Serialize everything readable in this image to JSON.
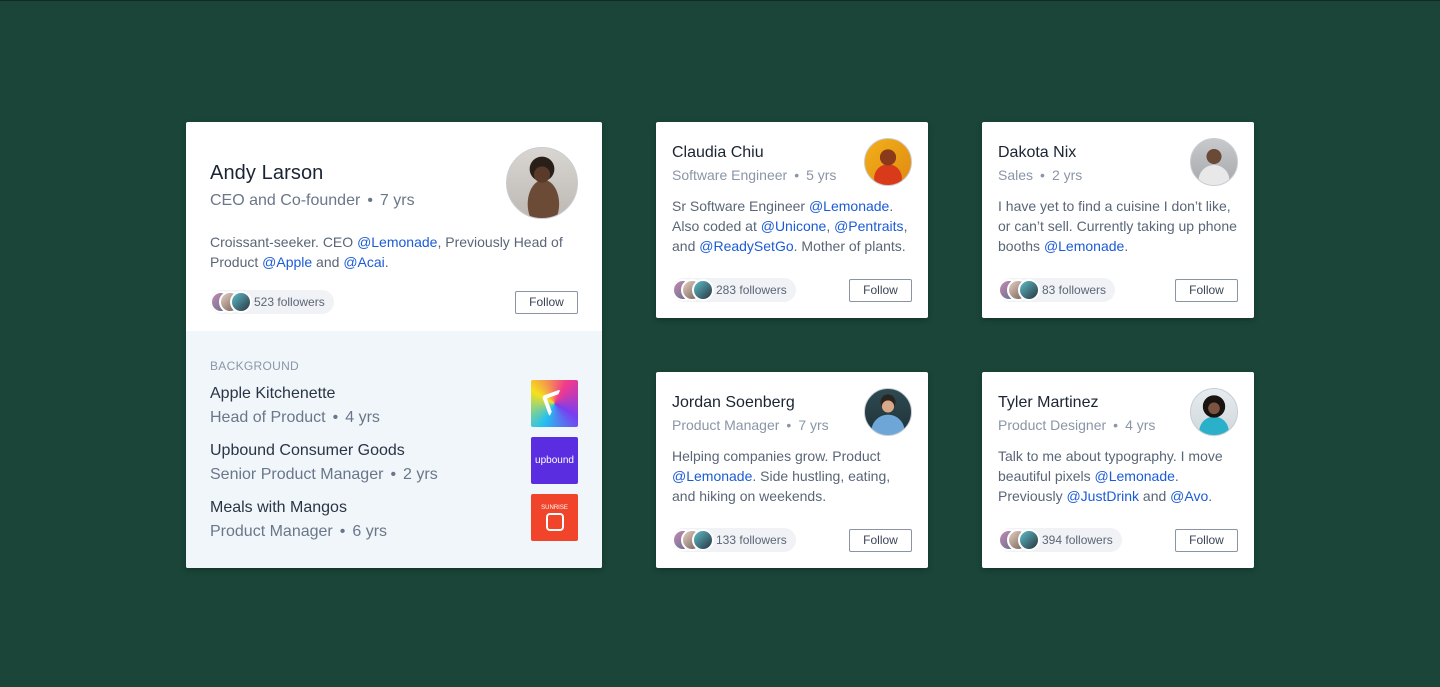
{
  "colors": {
    "background": "#1a4538",
    "link": "#1b5bd6",
    "section_bg": "#f1f6fb"
  },
  "featured": {
    "name": "Andy Larson",
    "title": "CEO and Co-founder",
    "tenure": "7 yrs",
    "separator": "•",
    "bio": {
      "t1": "Croissant-seeker. CEO ",
      "l1": "@Lemonade",
      "t2": ", Previously Head of Product ",
      "l2": "@Apple",
      "t3": " and ",
      "l3": "@Acai",
      "t4": "."
    },
    "followers": "523 followers",
    "follow_label": "Follow",
    "background": {
      "heading": "BACKGROUND",
      "jobs": [
        {
          "company": "Apple Kitchenette",
          "position": "Head of Product",
          "tenure": "4 yrs",
          "logo": "kitchenette-logo"
        },
        {
          "company": "Upbound Consumer Goods",
          "position": "Senior Product Manager",
          "tenure": "2 yrs",
          "logo": "upbound-logo",
          "logo_text": "upbound"
        },
        {
          "company": "Meals with Mangos",
          "position": "Product Manager",
          "tenure": "6 yrs",
          "logo": "sunrise-logo",
          "logo_text": "SUNRISE"
        }
      ]
    }
  },
  "people": [
    {
      "name": "Claudia Chiu",
      "title": "Software Engineer",
      "tenure": "5 yrs",
      "bio": {
        "t1": "Sr Software Engineer ",
        "l1": "@Lemonade",
        "t2": ". Also coded at ",
        "l2": "@Unicone",
        "t3": ", ",
        "l3": "@Pentraits",
        "t4": ", and ",
        "l4": "@ReadySetGo",
        "t5": ". Mother of plants."
      },
      "followers": "283 followers",
      "follow_label": "Follow"
    },
    {
      "name": "Dakota Nix",
      "title": "Sales",
      "tenure": "2 yrs",
      "bio": {
        "t1": "I have yet to find a cuisine I don’t like, or can’t sell. Currently taking up phone booths ",
        "l1": "@Lemonade",
        "t2": "."
      },
      "followers": "83 followers",
      "follow_label": "Follow"
    },
    {
      "name": "Jordan Soenberg",
      "title": "Product Manager",
      "tenure": "7 yrs",
      "bio": {
        "t1": "Helping companies grow. Product ",
        "l1": "@Lemonade",
        "t2": ". Side hustling, eating, and hiking on weekends."
      },
      "followers": "133 followers",
      "follow_label": "Follow"
    },
    {
      "name": "Tyler Martinez",
      "title": "Product Designer",
      "tenure": "4 yrs",
      "bio": {
        "t1": "Talk to me about typography. I move beautiful pixels ",
        "l1": "@Lemonade",
        "t2": ". Previously ",
        "l2": "@JustDrink",
        "t3": " and ",
        "l3": "@Avo",
        "t4": "."
      },
      "followers": "394 followers",
      "follow_label": "Follow"
    }
  ]
}
